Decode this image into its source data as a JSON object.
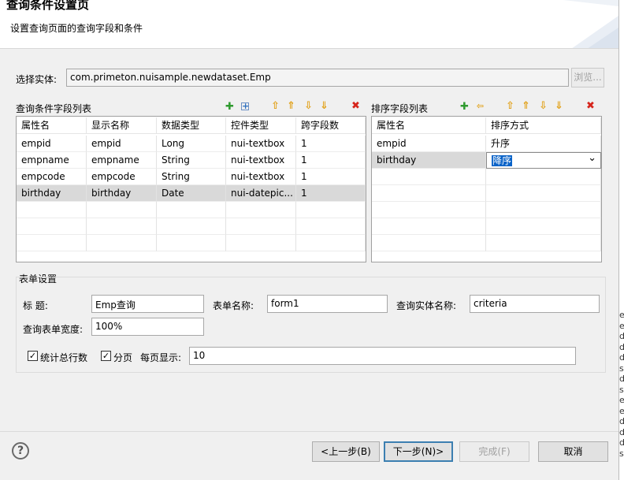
{
  "header": {
    "title": "查询条件设置页",
    "description": "设置查询页面的查询字段和条件"
  },
  "entity": {
    "label": "选择实体:",
    "value": "com.primeton.nuisample.newdataset.Emp",
    "browse_label": "浏览..."
  },
  "query_fields": {
    "title": "查询条件字段列表",
    "columns": [
      "属性名",
      "显示名称",
      "数据类型",
      "控件类型",
      "跨字段数"
    ],
    "rows": [
      [
        "empid",
        "empid",
        "Long",
        "nui-textbox",
        "1"
      ],
      [
        "empname",
        "empname",
        "String",
        "nui-textbox",
        "1"
      ],
      [
        "empcode",
        "empcode",
        "String",
        "nui-textbox",
        "1"
      ],
      [
        "birthday",
        "birthday",
        "Date",
        "nui-datepic...",
        "1"
      ]
    ],
    "selected_row": 3
  },
  "sort_fields": {
    "title": "排序字段列表",
    "columns": [
      "属性名",
      "排序方式"
    ],
    "rows": [
      [
        "empid",
        "升序"
      ],
      [
        "birthday",
        "降序"
      ]
    ],
    "selected_row": 1
  },
  "form_settings": {
    "legend": "表单设置",
    "title_label": "标    题:",
    "title_value": "Emp查询",
    "form_name_label": "表单名称:",
    "form_name_value": "form1",
    "query_entity_label": "查询实体名称:",
    "query_entity_value": "criteria",
    "width_label": "查询表单宽度:",
    "width_value": "100%",
    "count_label": "统计总行数",
    "count_checked": true,
    "paging_label": "分页",
    "paging_checked": true,
    "page_size_label": "每页显示:",
    "page_size_value": "10"
  },
  "footer": {
    "help": "?",
    "prev_label": "<上一步(B)",
    "next_label": "下一步(N)>",
    "finish_label": "完成(F)",
    "cancel_label": "取消"
  },
  "side_strip_text": [
    "e",
    "e",
    "d",
    "d",
    "d",
    "s",
    "d",
    "s",
    "e",
    "e",
    "d",
    "d",
    "d",
    "s"
  ]
}
